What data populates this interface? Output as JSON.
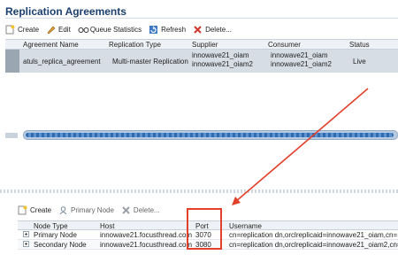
{
  "title": "Replication Agreements",
  "toolbar_top": {
    "create": "Create",
    "edit": "Edit",
    "queue": "Queue Statistics",
    "refresh": "Refresh",
    "delete": "Delete..."
  },
  "agreements_table": {
    "headers": [
      "Agreement Name",
      "Replication Type",
      "Supplier",
      "Consumer",
      "Status"
    ],
    "row": {
      "name": "atuls_replica_agreement",
      "type": "Multi-master Replication",
      "supplier_1": "innowave21_oiam",
      "supplier_2": "innowave21_oiam2",
      "consumer_1": "innowave21_oiam",
      "consumer_2": "innowave21_oiam2",
      "status": "Live"
    }
  },
  "toolbar_bottom": {
    "create": "Create",
    "primary": "Primary Node",
    "delete": "Delete..."
  },
  "nodes_table": {
    "headers": [
      "Node Type",
      "Host",
      "Port",
      "Username"
    ],
    "rows": [
      {
        "type": "Primary Node",
        "host": "innowave21.focusthread.com",
        "port": "3070",
        "user": "cn=replication dn,orclreplicaid=innowave21_oiam,cn="
      },
      {
        "type": "Secondary Node",
        "host": "innowave21.focusthread.com",
        "port": "3080",
        "user": "cn=replication dn,orclreplicaid=innowave21_oiam2,cn="
      }
    ]
  },
  "colors": {
    "accent": "#1b3f6e",
    "annotation": "#e2402a"
  }
}
